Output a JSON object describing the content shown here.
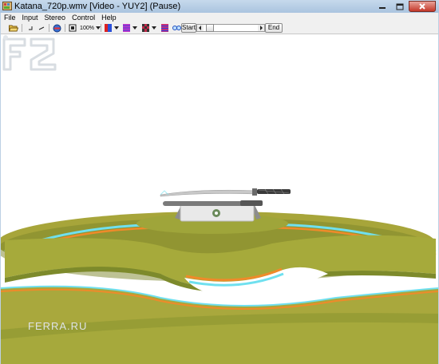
{
  "window": {
    "title": "Katana_720p.wmv [Video - YUY2] (Pause)"
  },
  "menu": {
    "items": [
      "File",
      "Input",
      "Stereo",
      "Control",
      "Help"
    ]
  },
  "toolbar": {
    "zoom_label": "100%",
    "start_label": "Start",
    "end_label": "End"
  },
  "playback": {
    "seek_position": 0.03
  },
  "watermark": {
    "text": "FERRA.RU",
    "logo_text": "F2"
  },
  "colors": {
    "grass": "#a5a83a",
    "grass_dark": "#7f8a2c",
    "ring_orange": "#ef8a2a",
    "ring_cyan": "#6fe0ef"
  }
}
